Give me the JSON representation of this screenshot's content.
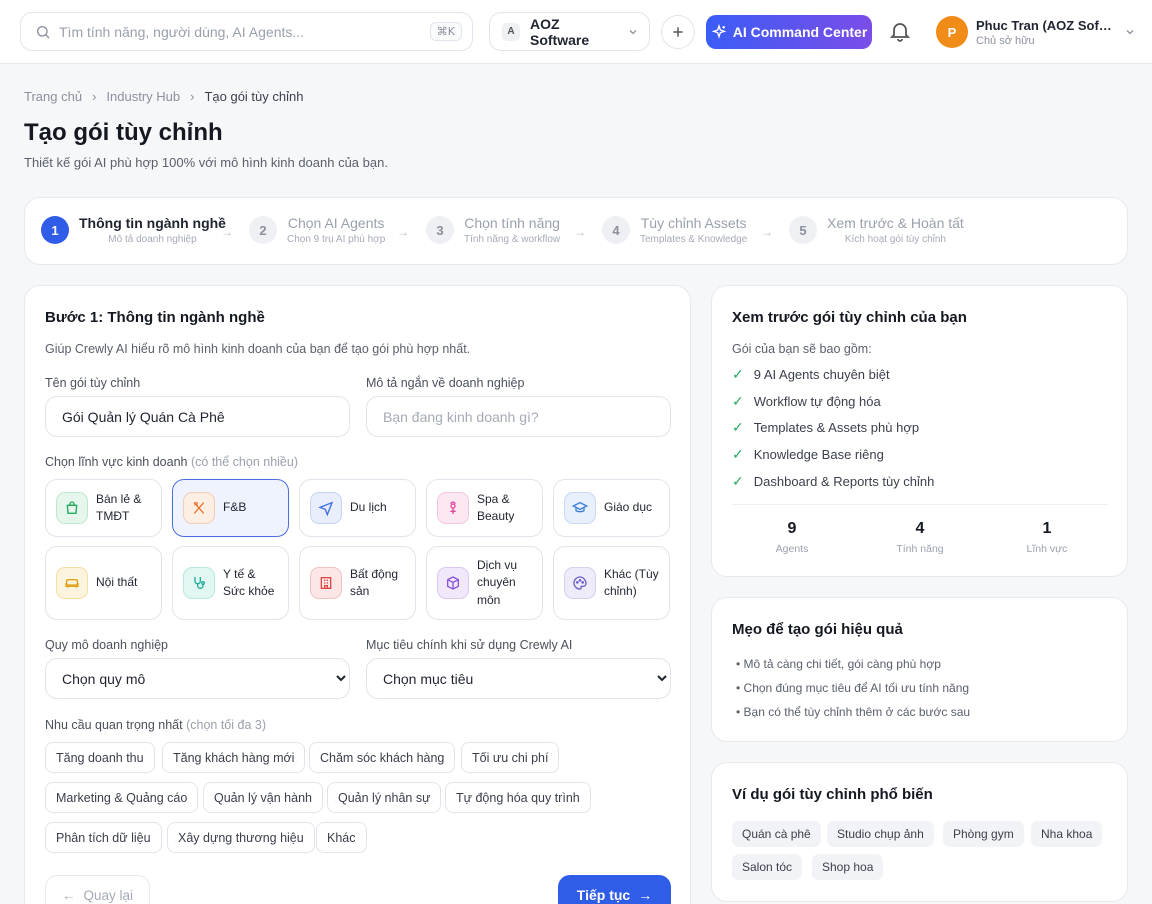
{
  "topbar": {
    "search_placeholder": "Tìm tính năng, người dùng, AI Agents...",
    "search_shortcut": "⌘K",
    "org_initial": "A",
    "org_name": "AOZ Software",
    "ai_command_label": "AI Command Center",
    "user_initial": "P",
    "user_name": "Phuc Tran (AOZ Software)",
    "user_role": "Chủ sở hữu"
  },
  "breadcrumb": [
    "Trang chủ",
    "Industry Hub",
    "Tạo gói tùy chỉnh"
  ],
  "page": {
    "title": "Tạo gói tùy chỉnh",
    "subtitle": "Thiết kế gói AI phù hợp 100% với mô hình kinh doanh của bạn."
  },
  "steps": [
    {
      "num": "1",
      "label": "Thông tin ngành nghề",
      "sub": "Mô tả doanh nghiệp"
    },
    {
      "num": "2",
      "label": "Chọn AI Agents",
      "sub": "Chọn 9 trụ AI phù hợp"
    },
    {
      "num": "3",
      "label": "Chọn tính năng",
      "sub": "Tính năng & workflow"
    },
    {
      "num": "4",
      "label": "Tùy chỉnh Assets",
      "sub": "Templates & Knowledge"
    },
    {
      "num": "5",
      "label": "Xem trước & Hoàn tất",
      "sub": "Kích hoạt gói tùy chỉnh"
    }
  ],
  "form": {
    "heading": "Bước 1: Thông tin ngành nghề",
    "description": "Giúp Crewly AI hiểu rõ mô hình kinh doanh của bạn để tạo gói phù hợp nhất.",
    "package_name_label": "Tên gói tùy chỉnh",
    "package_name_value": "Gói Quản lý Quán Cà Phê",
    "business_desc_label": "Mô tả ngắn về doanh nghiệp",
    "business_desc_placeholder": "Bạn đang kinh doanh gì?",
    "fields_label": "Chọn lĩnh vực kinh doanh",
    "fields_hint": "(có thể chọn nhiều)",
    "categories": [
      {
        "label": "Bán lẻ & TMĐT",
        "icon": "shopping-bag-icon",
        "color": "#21a95e"
      },
      {
        "label": "F&B",
        "icon": "utensils-icon",
        "color": "#e8742c"
      },
      {
        "label": "Du lịch",
        "icon": "plane-icon",
        "color": "#3b6fe0"
      },
      {
        "label": "Spa & Beauty",
        "icon": "flower-icon",
        "color": "#e0459a"
      },
      {
        "label": "Giáo dục",
        "icon": "graduation-cap-icon",
        "color": "#3f7fd8"
      },
      {
        "label": "Nội thất",
        "icon": "sofa-icon",
        "color": "#e0a11a"
      },
      {
        "label": "Y tế & Sức khỏe",
        "icon": "stethoscope-icon",
        "color": "#1fae9a"
      },
      {
        "label": "Bất động sản",
        "icon": "building-icon",
        "color": "#e04848"
      },
      {
        "label": "Dịch vụ chuyên môn",
        "icon": "box-icon",
        "color": "#8a55d8"
      },
      {
        "label": "Khác (Tùy chỉnh)",
        "icon": "palette-icon",
        "color": "#6a62c8"
      }
    ],
    "scale_label": "Quy mô doanh nghiệp",
    "scale_value": "Chọn quy mô",
    "goal_label": "Mục tiêu chính khi sử dụng Crewly AI",
    "goal_value": "Chọn mục tiêu",
    "needs_label": "Nhu cầu quan trọng nhất",
    "needs_hint": "(chọn tối đa 3)",
    "needs": [
      "Tăng doanh thu",
      "Tăng khách hàng mới",
      "Chăm sóc khách hàng",
      "Tối ưu chi phí",
      "Marketing & Quảng cáo",
      "Quản lý vận hành",
      "Quản lý nhân sự",
      "Tự động hóa quy trình",
      "Phân tích dữ liệu",
      "Xây dựng thương hiệu",
      "Khác"
    ],
    "back_label": "Quay lại",
    "next_label": "Tiếp tục"
  },
  "preview": {
    "heading": "Xem trước gói tùy chỉnh của bạn",
    "intro": "Gói của bạn sẽ bao gồm:",
    "items": [
      "9 AI Agents chuyên biệt",
      "Workflow tự động hóa",
      "Templates & Assets phù hợp",
      "Knowledge Base riêng",
      "Dashboard & Reports tùy chỉnh"
    ],
    "stats": [
      {
        "value": "9",
        "label": "Agents"
      },
      {
        "value": "4",
        "label": "Tính năng"
      },
      {
        "value": "1",
        "label": "Lĩnh vực"
      }
    ]
  },
  "tips": {
    "heading": "Mẹo để tạo gói hiệu quả",
    "items": [
      "• Mô tả càng chi tiết, gói càng phù hợp",
      "• Chọn đúng mục tiêu để AI tối ưu tính năng",
      "• Bạn có thể tùy chỉnh thêm ở các bước sau"
    ]
  },
  "examples": {
    "heading": "Ví dụ gói tùy chỉnh phổ biến",
    "items": [
      "Quán cà phê",
      "Studio chụp ảnh",
      "Phòng gym",
      "Nha khoa",
      "Salon tóc",
      "Shop hoa"
    ]
  },
  "colors": {
    "primary": "#2f5de8",
    "accent_start": "#3b5cf6",
    "accent_end": "#7b4de8",
    "check": "#21a95e"
  }
}
